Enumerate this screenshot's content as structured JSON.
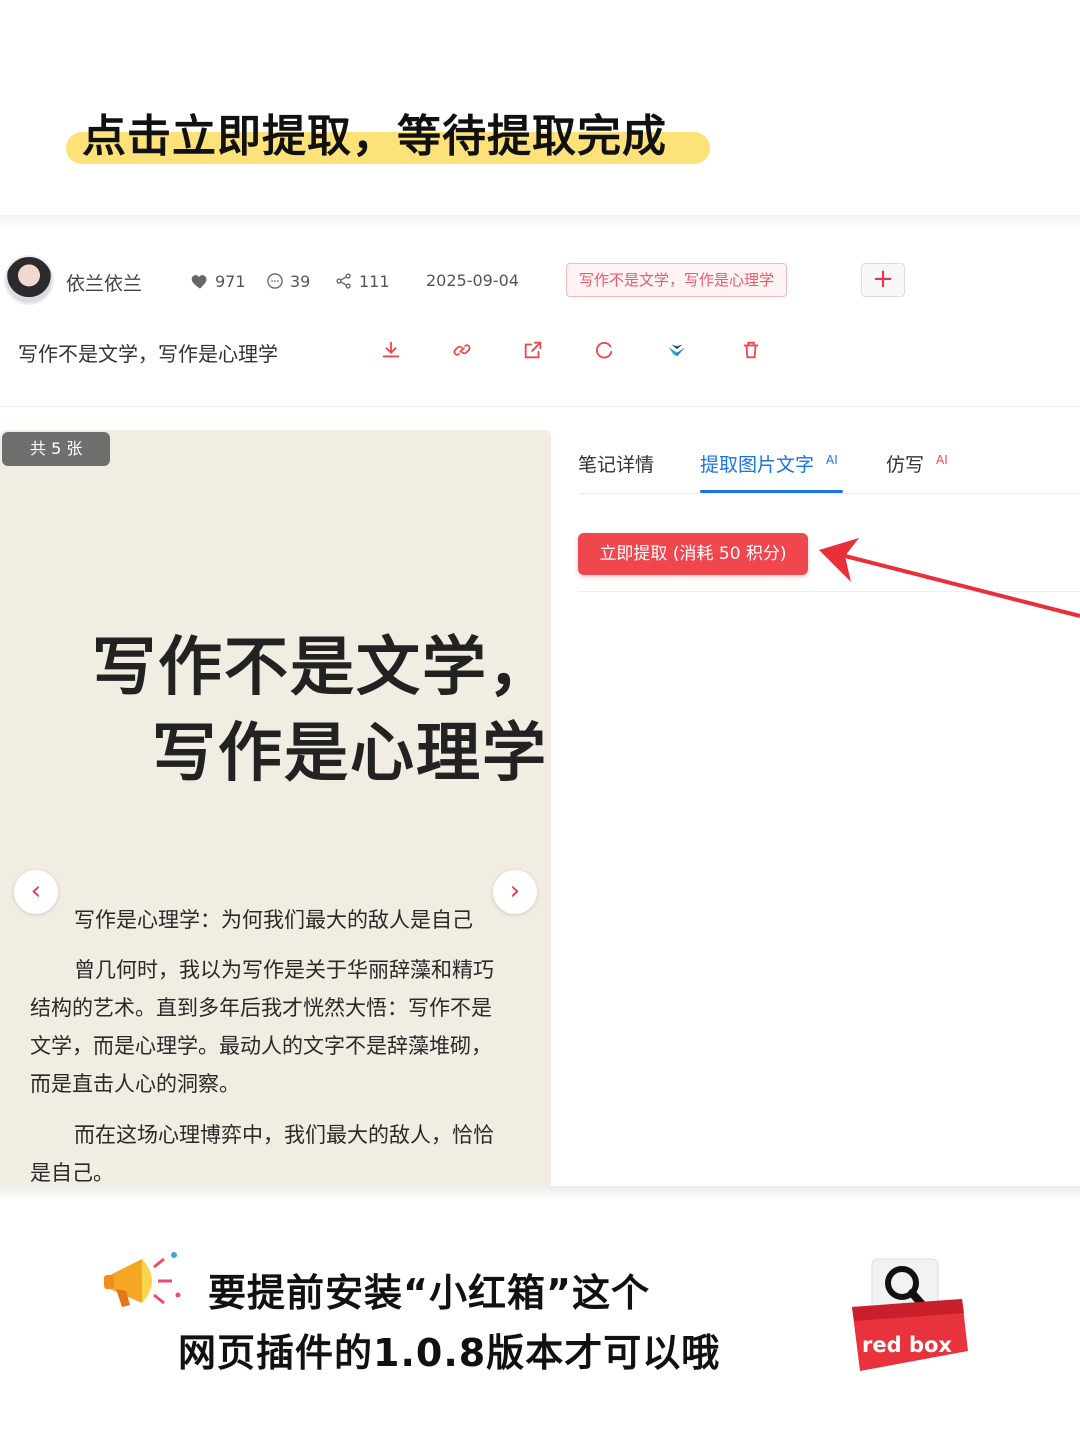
{
  "headline": "点击立即提取，等待提取完成",
  "author": {
    "name": "依兰依兰",
    "likes": "971",
    "comments": "39",
    "shares": "111",
    "date": "2025-09-04",
    "tag": "写作不是文学，写作是心理学",
    "add_label": "+"
  },
  "note": {
    "title": "写作不是文学，写作是心理学",
    "tools": [
      "download-icon",
      "link-icon",
      "open-external-icon",
      "refresh-icon",
      "app-logo-icon",
      "trash-icon"
    ]
  },
  "image": {
    "count": "共 5 张",
    "poem_line1": "写作不是文学，",
    "poem_line2": "写作是心理学",
    "body": [
      "写作是心理学：为何我们最大的敌人是自己",
      "曾几何时，我以为写作是关于华丽辞藻和精巧",
      "结构的艺术。直到多年后我才恍然大悟：写作不是",
      "文学，而是心理学。最动人的文字不是辞藻堆砌，",
      "而是直击人心的洞察。",
      "而在这场心理博弈中，我们最大的敌人，恰恰",
      "是自己。"
    ],
    "prev": "‹",
    "next": "›"
  },
  "tabs": [
    {
      "label": "笔记详情",
      "ai": ""
    },
    {
      "label": "提取图片文字",
      "ai": "AI"
    },
    {
      "label": "仿写",
      "ai": "AI"
    }
  ],
  "extract_button": "立即提取 (消耗 50 积分)",
  "notice": {
    "line1": "要提前安装“小红箱”这个",
    "line2": "网页插件的1.0.8版本才可以哦"
  },
  "logo_text": "red box",
  "colors": {
    "accent_red": "#f0464d",
    "tab_blue": "#1a73e8",
    "highlight_yellow": "#fde27a"
  }
}
